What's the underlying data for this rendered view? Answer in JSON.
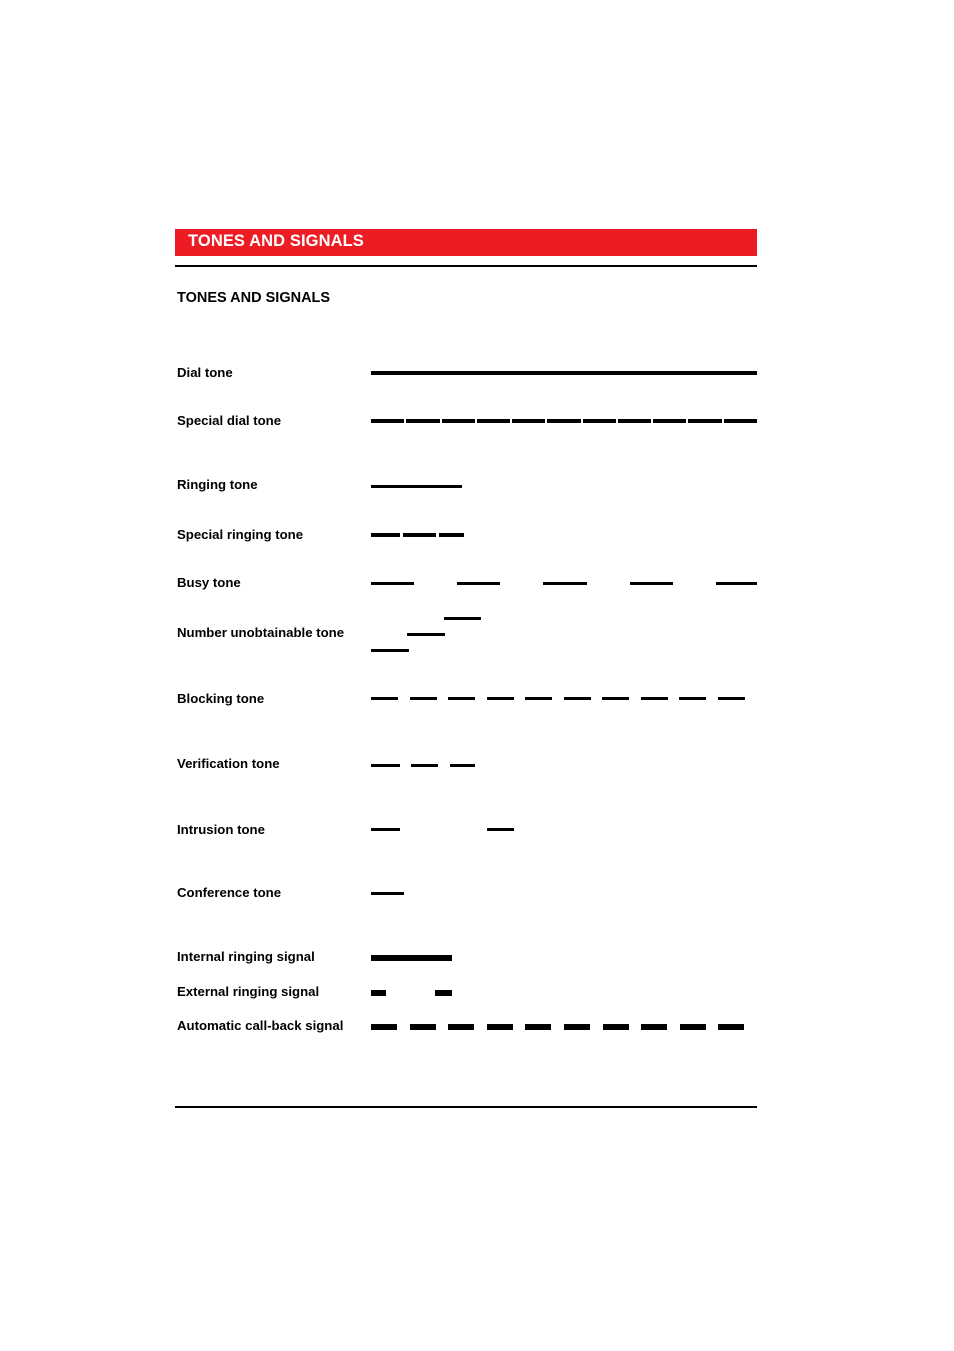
{
  "header": {
    "title": "TONES AND SIGNALS",
    "accent_color": "#ed1c24"
  },
  "section": {
    "title": "TONES AND SIGNALS"
  },
  "tones": [
    {
      "id": "dial-tone",
      "label": "Dial tone",
      "pattern": "continuous"
    },
    {
      "id": "special-dial-tone",
      "label": "Special dial tone",
      "pattern": "continuous with short interruptions"
    },
    {
      "id": "ringing-tone",
      "label": "Ringing tone",
      "pattern": "single long burst"
    },
    {
      "id": "special-ringing-tone",
      "label": "Special ringing tone",
      "pattern": "long burst with short interruptions"
    },
    {
      "id": "busy-tone",
      "label": "Busy tone",
      "pattern": "on/off equal intervals"
    },
    {
      "id": "number-unobtainable-tone",
      "label": "Number unobtainable tone",
      "pattern": "three ascending steps"
    },
    {
      "id": "blocking-tone",
      "label": "Blocking tone",
      "pattern": "rapid short bursts"
    },
    {
      "id": "verification-tone",
      "label": "Verification tone",
      "pattern": "three short bursts"
    },
    {
      "id": "intrusion-tone",
      "label": "Intrusion tone",
      "pattern": "two short bursts, long pause"
    },
    {
      "id": "conference-tone",
      "label": "Conference tone",
      "pattern": "single short burst"
    },
    {
      "id": "internal-ringing-signal",
      "label": "Internal ringing signal",
      "pattern": "single long burst"
    },
    {
      "id": "external-ringing-signal",
      "label": "External ringing signal",
      "pattern": "two short bursts"
    },
    {
      "id": "automatic-call-back-signal",
      "label": "Automatic call-back signal",
      "pattern": "repeated short bursts"
    }
  ]
}
